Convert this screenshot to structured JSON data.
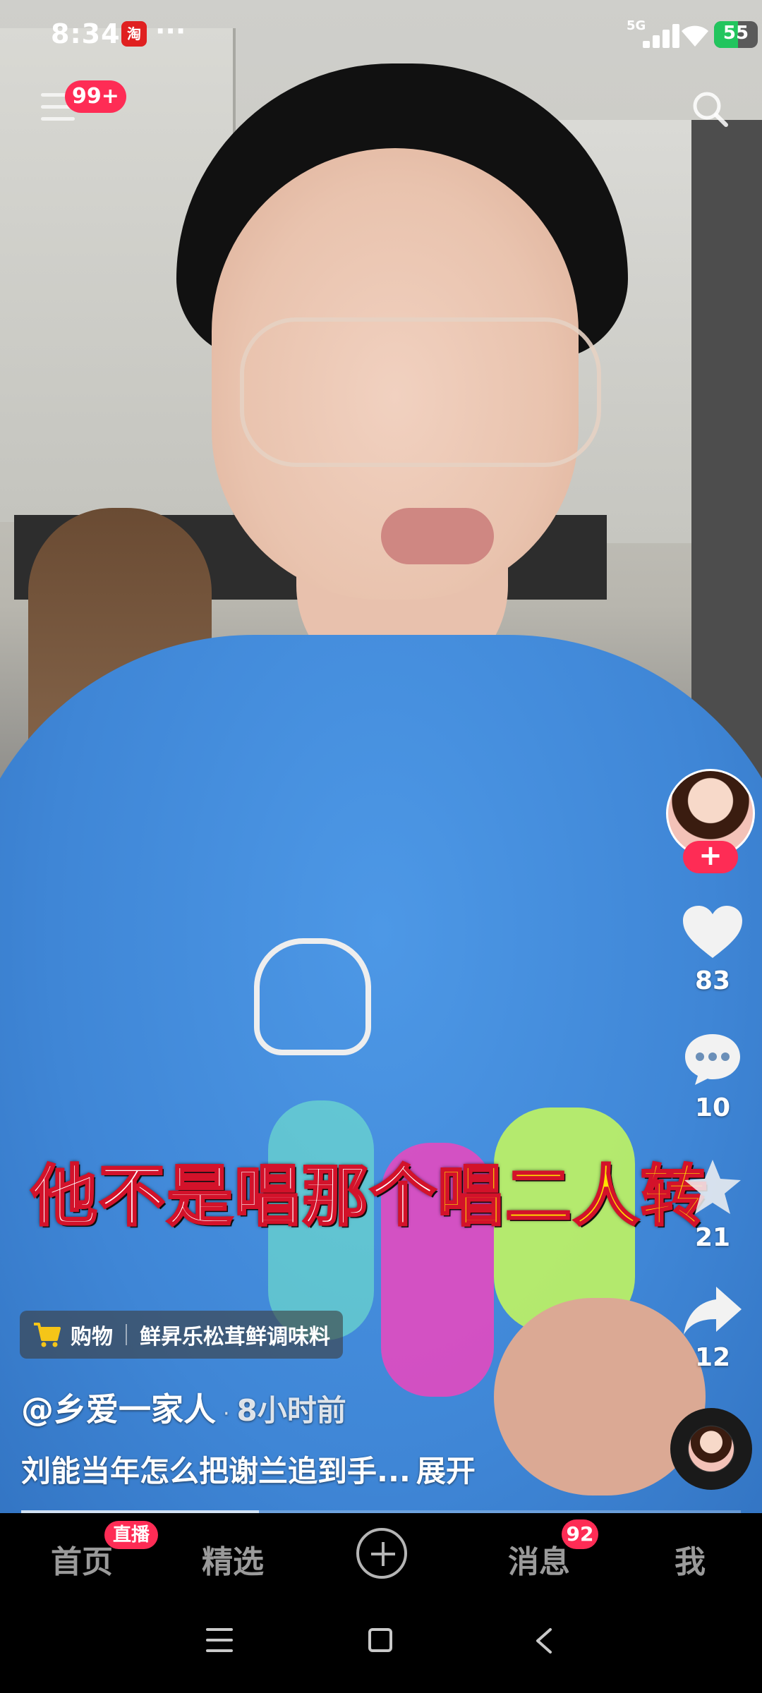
{
  "status_bar": {
    "time": "8:34",
    "app_icon_text": "淘",
    "more": "···",
    "network": "5G",
    "battery": "55"
  },
  "top_bar": {
    "menu_badge": "99+"
  },
  "subtitle": {
    "part1": "他不是唱那个",
    "part2": "唱二人转"
  },
  "actions": {
    "follow": "+",
    "likes": "83",
    "comments": "10",
    "favorites": "21",
    "shares": "12"
  },
  "shop": {
    "label": "购物",
    "product": "鲜昇乐松茸鲜调味料"
  },
  "post": {
    "author": "@乡爱一家人",
    "dot": "·",
    "time": "8小时前",
    "description": "刘能当年怎么把谢兰追到手...",
    "expand": "展开"
  },
  "bottom_nav": {
    "home": "首页",
    "live_badge": "直播",
    "featured": "精选",
    "messages": "消息",
    "messages_badge": "92",
    "me": "我"
  },
  "colors": {
    "accent": "#fe2c55",
    "subtitle_yellow": "#ffe000",
    "cart": "#f5c518"
  }
}
